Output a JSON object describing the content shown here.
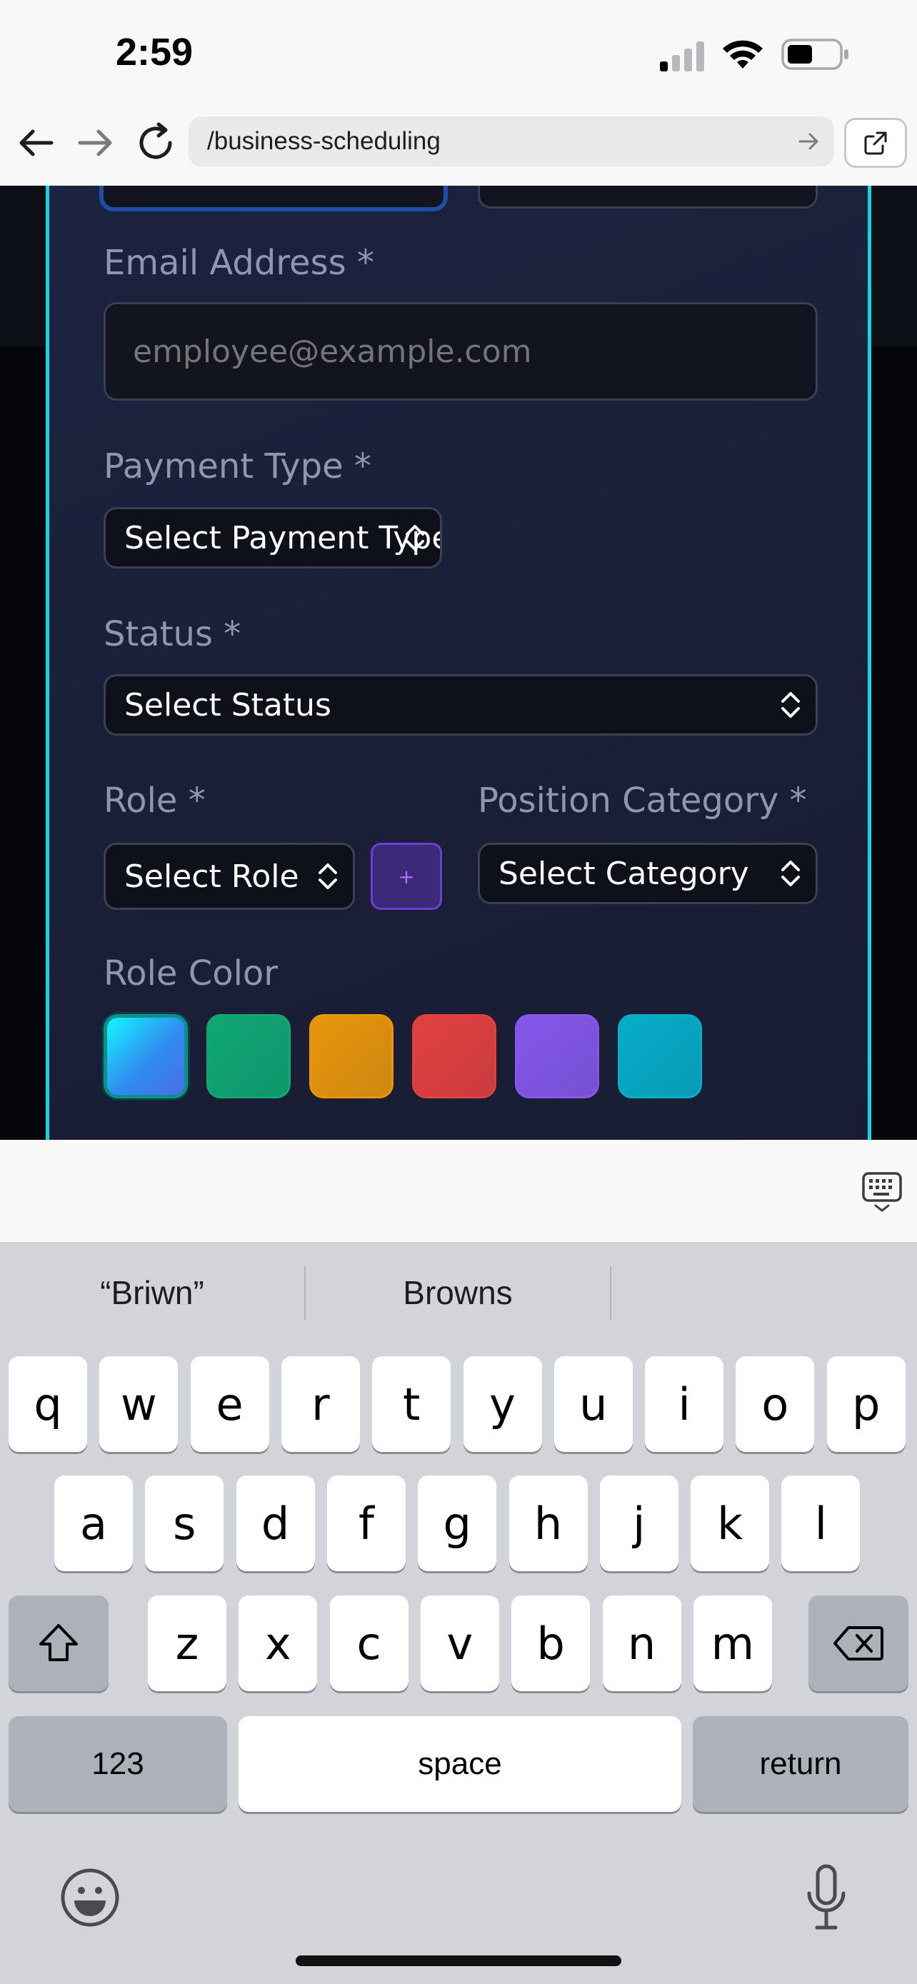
{
  "status_bar": {
    "time": "2:59"
  },
  "browser": {
    "url": "/business-scheduling"
  },
  "form": {
    "email": {
      "label": "Email Address *",
      "placeholder": "employee@example.com"
    },
    "payment_type": {
      "label": "Payment Type *",
      "selected": "Select Payment Type"
    },
    "status": {
      "label": "Status *",
      "selected": "Select Status"
    },
    "role": {
      "label": "Role *",
      "selected": "Select Role",
      "add_label": "+"
    },
    "position_category": {
      "label": "Position Category *",
      "selected": "Select Category"
    },
    "role_color": {
      "label": "Role Color",
      "swatches": [
        "#22c5f0",
        "#10b07a",
        "#f59e0b",
        "#ef4444",
        "#8b5cf6",
        "#06b6d4"
      ],
      "selected_index": 0
    }
  },
  "colors": {
    "accent_border": "#14d4e0",
    "modal_bg": "#1c2340"
  },
  "keyboard": {
    "suggestions": [
      "“Briwn”",
      "Browns",
      ""
    ],
    "row1": [
      "q",
      "w",
      "e",
      "r",
      "t",
      "y",
      "u",
      "i",
      "o",
      "p"
    ],
    "row2": [
      "a",
      "s",
      "d",
      "f",
      "g",
      "h",
      "j",
      "k",
      "l"
    ],
    "row3": [
      "z",
      "x",
      "c",
      "v",
      "b",
      "n",
      "m"
    ],
    "numbers_label": "123",
    "space_label": "space",
    "return_label": "return"
  }
}
